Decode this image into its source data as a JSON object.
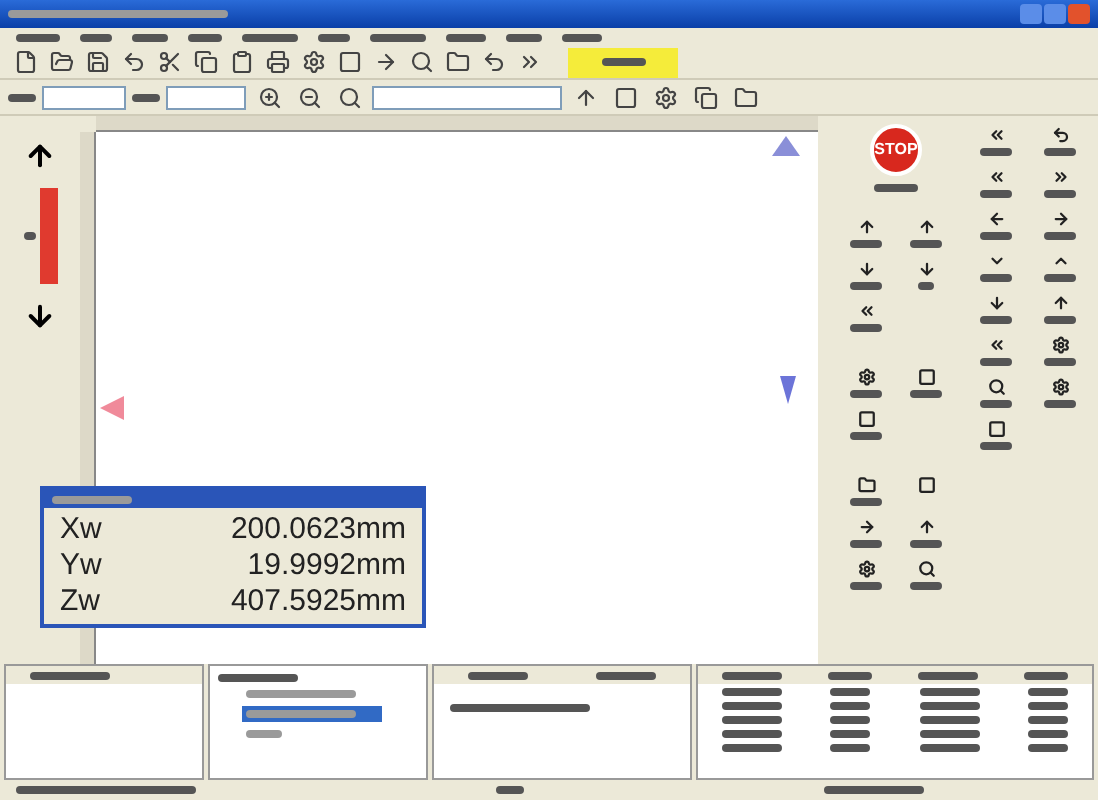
{
  "stop_button": {
    "label": "STOP"
  },
  "coordinate_readout": {
    "rows": [
      {
        "axis": "Xw",
        "value": "200.0623mm"
      },
      {
        "axis": "Yw",
        "value": "19.9992mm"
      },
      {
        "axis": "Zw",
        "value": "407.5925mm"
      }
    ]
  },
  "tree": {
    "items": [
      {
        "selected": false
      },
      {
        "selected": true
      },
      {
        "selected": false
      }
    ]
  }
}
